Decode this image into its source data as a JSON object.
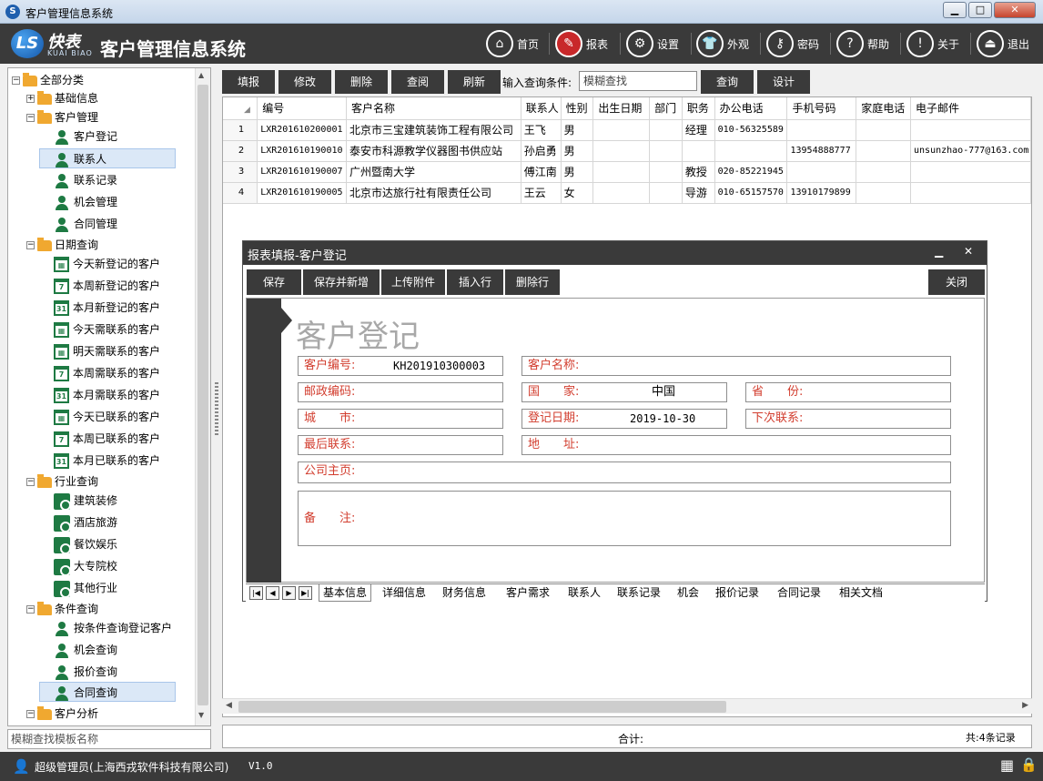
{
  "window": {
    "title": "客户管理信息系统",
    "minimize": "▁",
    "maximize": "□",
    "close": "✕"
  },
  "header": {
    "logo_cn": "快表",
    "logo_en": "KUAI BIAO",
    "logo_mark": "LS",
    "app_title": "客户管理信息系统",
    "buttons": [
      {
        "label": "首页",
        "icon": "home-icon",
        "glyph": "⌂"
      },
      {
        "label": "报表",
        "icon": "report-icon",
        "glyph": "✎"
      },
      {
        "label": "设置",
        "icon": "gear-icon",
        "glyph": "⚙"
      },
      {
        "label": "外观",
        "icon": "shirt-icon",
        "glyph": "👕"
      },
      {
        "label": "密码",
        "icon": "key-icon",
        "glyph": "⚷"
      },
      {
        "label": "帮助",
        "icon": "help-icon",
        "glyph": "?"
      },
      {
        "label": "关于",
        "icon": "info-icon",
        "glyph": "!"
      },
      {
        "label": "退出",
        "icon": "exit-icon",
        "glyph": "⏏"
      }
    ]
  },
  "tree": {
    "root": "全部分类",
    "basic": "基础信息",
    "customer_mgmt": "客户管理",
    "customer_items": [
      "客户登记",
      "联系人",
      "联系记录",
      "机会管理",
      "合同管理"
    ],
    "date_query": "日期查询",
    "date_items": [
      {
        "label": "今天新登记的客户",
        "cal": "▦"
      },
      {
        "label": "本周新登记的客户",
        "cal": "7"
      },
      {
        "label": "本月新登记的客户",
        "cal": "31"
      },
      {
        "label": "今天需联系的客户",
        "cal": "▦"
      },
      {
        "label": "明天需联系的客户",
        "cal": "▦"
      },
      {
        "label": "本周需联系的客户",
        "cal": "7"
      },
      {
        "label": "本月需联系的客户",
        "cal": "31"
      },
      {
        "label": "今天已联系的客户",
        "cal": "▦"
      },
      {
        "label": "本周已联系的客户",
        "cal": "7"
      },
      {
        "label": "本月已联系的客户",
        "cal": "31"
      }
    ],
    "industry_query": "行业查询",
    "industry_items": [
      "建筑装修",
      "酒店旅游",
      "餐饮娱乐",
      "大专院校",
      "其他行业"
    ],
    "condition_query": "条件查询",
    "condition_items": [
      "按条件查询登记客户",
      "机会查询",
      "报价查询",
      "合同查询"
    ],
    "customer_analysis": "客户分析",
    "search_placeholder": "模糊查找模板名称"
  },
  "toolbar": {
    "buttons": [
      "填报",
      "修改",
      "删除",
      "查阅",
      "刷新"
    ],
    "query_label": "输入查询条件:",
    "query_value": "模糊查找",
    "search_btn": "查询",
    "design_btn": "设计"
  },
  "table": {
    "columns": [
      "编号",
      "客户名称",
      "联系人",
      "性别",
      "出生日期",
      "部门",
      "职务",
      "办公电话",
      "手机号码",
      "家庭电话",
      "电子邮件"
    ],
    "rows": [
      [
        "1",
        "LXR201610200001",
        "北京市三宝建筑装饰工程有限公司",
        "王飞",
        "男",
        "",
        "",
        "经理",
        "010-56325589",
        "",
        "",
        ""
      ],
      [
        "2",
        "LXR201610190010",
        "泰安市科源教学仪器图书供应站",
        "孙启勇",
        "男",
        "",
        "",
        "",
        "",
        "13954888777",
        "",
        "unsunzhao-777@163.com"
      ],
      [
        "3",
        "LXR201610190007",
        "广州暨南大学",
        "傅江南",
        "男",
        "",
        "",
        "教授",
        "020-85221945",
        "",
        "",
        ""
      ],
      [
        "4",
        "LXR201610190005",
        "北京市达旅行社有限责任公司",
        "王云",
        "女",
        "",
        "",
        "导游",
        "010-65157570",
        "13910179899",
        "",
        ""
      ]
    ],
    "footer_total_label": "合计:",
    "footer_count": "共:4条记录"
  },
  "dialog": {
    "title": "报表填报-客户登记",
    "min": "▁",
    "close": "✕",
    "buttons": [
      "保存",
      "保存并新增",
      "上传附件",
      "插入行",
      "删除行"
    ],
    "close_btn": "关闭",
    "form_title": "客户登记",
    "fields": {
      "customer_no_label": "客户编号:",
      "customer_no_value": "KH201910300003",
      "customer_name_label": "客户名称:",
      "postal_label": "邮政编码:",
      "country_label": "国　　家:",
      "country_value": "中国",
      "province_label": "省　　份:",
      "city_label": "城　　市:",
      "reg_date_label": "登记日期:",
      "reg_date_value": "2019-10-30",
      "next_contact_label": "下次联系:",
      "last_contact_label": "最后联系:",
      "address_label": "地　　址:",
      "homepage_label": "公司主页:",
      "remark_label": "备　　注:"
    },
    "tabs": [
      "基本信息",
      "详细信息",
      "财务信息",
      "客户需求",
      "联系人",
      "联系记录",
      "机会",
      "报价记录",
      "合同记录",
      "相关文档"
    ],
    "nav": [
      "|◀",
      "◀",
      "▶",
      "▶|"
    ]
  },
  "status": {
    "user": "超级管理员(上海西戎软件科技有限公司)",
    "version": "V1.0"
  }
}
